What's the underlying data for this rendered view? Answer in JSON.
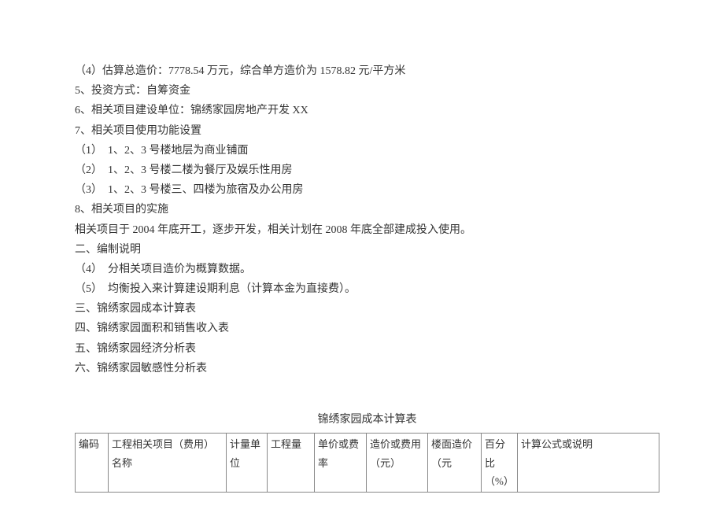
{
  "lines": {
    "l1": "（4）估算总造价：7778.54 万元，综合单方造价为 1578.82 元/平方米",
    "l2": "5、投资方式：自筹资金",
    "l3": "6、相关项目建设单位：锦绣家园房地产开发 XX",
    "l4": "7、相关项目使用功能设置",
    "l5": "（1）　1、2、3 号楼地层为商业铺面",
    "l6": "（2）　1、2、3 号楼二楼为餐厅及娱乐性用房",
    "l7": "（3）　1、2、3 号楼三、四楼为旅宿及办公用房",
    "l8": "8、相关项目的实施",
    "l9": "相关项目于 2004 年底开工，逐步开发，相关计划在 2008 年底全部建成投入使用。",
    "l10": "二、编制说明",
    "l11": "（4）　分相关项目造价为概算数据。",
    "l12": "（5）　均衡投入来计算建设期利息（计算本金为直接费）。",
    "l13": "三、锦绣家园成本计算表",
    "l14": "四、锦绣家园面积和销售收入表",
    "l15": "五、锦绣家园经济分析表",
    "l16": "六、锦绣家园敏感性分析表"
  },
  "table": {
    "title": "锦绣家园成本计算表",
    "headers": {
      "code": "编码",
      "name": "工程相关项目（费用）名称",
      "unit": "计量单位",
      "qty": "工程量",
      "price": "单价或费率",
      "cost": "造价或费用（元）",
      "floor": "楼面造价（元",
      "pct": "百分比（%）",
      "formula": "计算公式或说明"
    }
  }
}
